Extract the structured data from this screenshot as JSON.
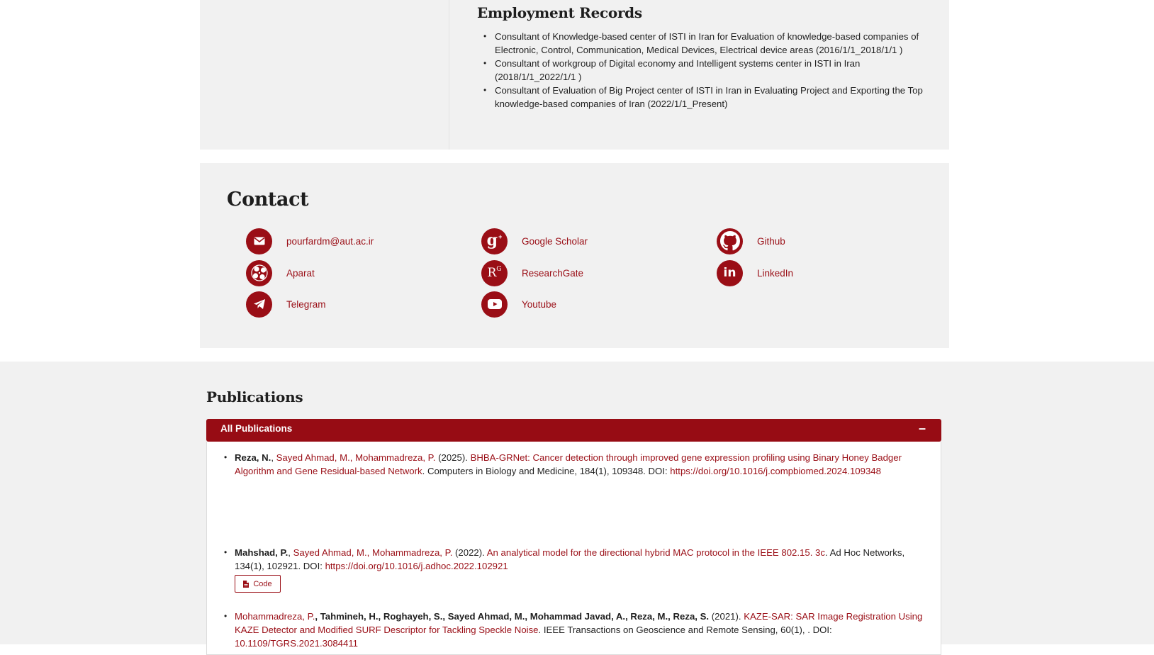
{
  "employment": {
    "title": "Employment Records",
    "items": [
      "Consultant of Knowledge-based center of ISTI in Iran for Evaluation of knowledge-based companies of Electronic, Control, Communication, Medical Devices, Electrical device areas (2016/1/1_2018/1/1 )",
      "Consultant of workgroup of Digital economy and Intelligent systems center in ISTI in Iran (2018/1/1_2022/1/1 )",
      "Consultant of Evaluation of Big Project center of ISTI in Iran in Evaluating Project and Exporting the Top knowledge-based companies of Iran (2022/1/1_Present)"
    ]
  },
  "contact": {
    "title": "Contact",
    "email": "pourfardm@aut.ac.ir",
    "google_scholar": "Google Scholar",
    "github": "Github",
    "aparat": "Aparat",
    "researchgate": "ResearchGate",
    "linkedin": "LinkedIn",
    "telegram": "Telegram",
    "youtube": "Youtube"
  },
  "publications": {
    "title": "Publications",
    "header": "All Publications",
    "collapse_symbol": "–",
    "code_label": "Code",
    "items": [
      {
        "a1": "Reza, N.",
        "sep1": ", ",
        "a2": "Sayed Ahmad, M.",
        "sep2": ", ",
        "a3": "Mohammadreza, P.",
        "year": " (2025). ",
        "title": "BHBA-GRNet: Cancer detection through improved gene expression profiling using Binary Honey Badger Algorithm and Gene Residual-based Network",
        "venue": ". Computers in Biology and Medicine, 184(1), 109348. DOI: ",
        "doi": "https://doi.org/10.1016/j.compbiomed.2024.109348"
      },
      {
        "a1": "Mahshad, P.",
        "sep1": ", ",
        "a2": "Sayed Ahmad, M.",
        "sep2": ", ",
        "a3": "Mohammadreza, P.",
        "year": " (2022). ",
        "title": "An analytical model for the directional hybrid MAC protocol in the IEEE 802.15. 3c",
        "venue": ". Ad Hoc Networks, 134(1), 102921. DOI: ",
        "doi": "https://doi.org/10.1016/j.adhoc.2022.102921"
      },
      {
        "a1": "Mohammadreza, P.",
        "rest_authors": ", Tahmineh, H., Roghayeh, S.,  Sayed Ahmad, M., Mohammad Javad, A., Reza, M., Reza, S.",
        "year": " (2021). ",
        "title": "KAZE-SAR: SAR Image Registration Using KAZE Detector and Modified SURF Descriptor for Tackling Speckle Noise",
        "venue": ". IEEE Transactions on Geoscience and Remote Sensing, 60(1), . DOI: ",
        "doi": "10.1109/TGRS.2021.3084411"
      }
    ]
  },
  "colors": {
    "accent": "#9a0e16",
    "panel": "#f1f1f1"
  },
  "icons": [
    "mail-icon",
    "google-scholar-icon",
    "github-icon",
    "aparat-icon",
    "researchgate-icon",
    "linkedin-icon",
    "telegram-icon",
    "youtube-icon",
    "file-icon"
  ]
}
